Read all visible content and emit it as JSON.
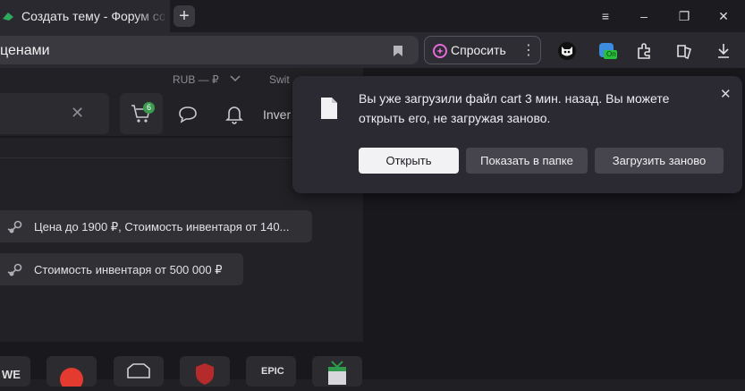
{
  "tab": {
    "title": "Создать тему - Форум со"
  },
  "window": {
    "new_tab": "+",
    "menu": "≡",
    "minimize": "–",
    "restore": "❐",
    "close": "✕"
  },
  "address": {
    "text": "ценами"
  },
  "toolbar": {
    "ask_label": "Спросить",
    "more": "⋮",
    "ext_badge": "On"
  },
  "site": {
    "currency": "RUB — ₽",
    "switch": "Swit",
    "cart_count": "6",
    "inventory": "Inver",
    "chips": [
      "Цена до 1900 ₽, Стоимость инвентаря от 140...",
      "Стоимость инвентаря от 500 000 ₽"
    ],
    "games": [
      "WE",
      "",
      "",
      "",
      "EPIC",
      ""
    ]
  },
  "download_notice": {
    "message": "Вы уже загрузили файл cart 3 мин. назад. Вы можете открыть его, не загружая заново.",
    "open_label": "Открыть",
    "show_in_folder_label": "Показать в папке",
    "redownload_label": "Загрузить заново",
    "close": "✕"
  }
}
